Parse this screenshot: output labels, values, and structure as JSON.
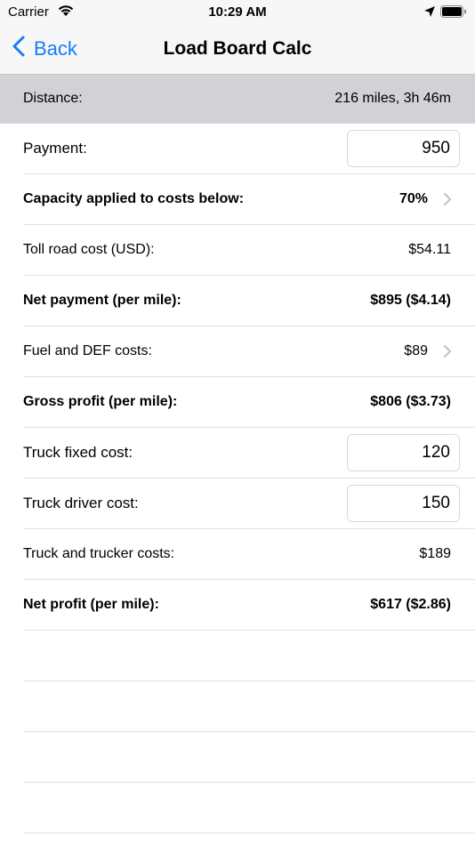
{
  "status": {
    "carrier": "Carrier",
    "time": "10:29 AM"
  },
  "nav": {
    "back_label": "Back",
    "title": "Load Board Calc"
  },
  "distance": {
    "label": "Distance:",
    "value": "216 miles, 3h 46m"
  },
  "rows": {
    "payment": {
      "label": "Payment:",
      "value": "950"
    },
    "capacity": {
      "label": "Capacity applied to costs below:",
      "value": "70%"
    },
    "toll": {
      "label": "Toll road cost (USD):",
      "value": "$54.11"
    },
    "net_payment": {
      "label": "Net payment (per mile):",
      "value": "$895 ($4.14)"
    },
    "fuel": {
      "label": "Fuel and DEF costs:",
      "value": "$89"
    },
    "gross_profit": {
      "label": "Gross profit (per mile):",
      "value": "$806 ($3.73)"
    },
    "truck_fixed": {
      "label": "Truck fixed cost:",
      "value": "120"
    },
    "truck_driver": {
      "label": "Truck driver cost:",
      "value": "150"
    },
    "truck_trucker": {
      "label": "Truck and trucker costs:",
      "value": "$189"
    },
    "net_profit": {
      "label": "Net profit (per mile):",
      "value": "$617 ($2.86)"
    }
  },
  "colors": {
    "accent": "#147efb",
    "section_header_bg": "#d1d1d6",
    "bar_bg": "#f7f7f7",
    "separator": "#e0e0e3",
    "chevron": "#c4c4c7"
  },
  "icons": {
    "wifi": "wifi-icon",
    "location": "location-arrow-icon",
    "battery": "battery-icon",
    "back": "chevron-left-icon",
    "disclosure": "chevron-right-icon"
  }
}
